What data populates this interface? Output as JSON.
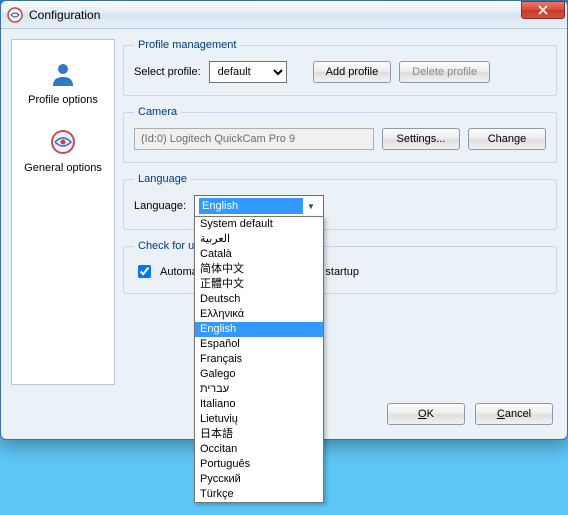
{
  "window": {
    "title": "Configuration"
  },
  "sidebar": {
    "items": [
      {
        "label": "Profile options",
        "icon": "user-icon"
      },
      {
        "label": "General options",
        "icon": "app-icon"
      }
    ]
  },
  "profile": {
    "legend": "Profile management",
    "select_label": "Select profile:",
    "selected": "default",
    "options": [
      "default"
    ],
    "add_btn": "Add profile",
    "delete_btn": "Delete profile"
  },
  "camera": {
    "legend": "Camera",
    "device": "(Id:0) Logitech QuickCam Pro 9",
    "settings_btn": "Settings...",
    "change_btn": "Change"
  },
  "language": {
    "legend": "Language",
    "label": "Language:",
    "selected": "English",
    "highlighted": "English",
    "options": [
      "System default",
      "العربية",
      "Català",
      "简体中文",
      "正體中文",
      "Deutsch",
      "Ελληνικά",
      "English",
      "Español",
      "Français",
      "Galego",
      "עברית",
      "Italiano",
      "Lietuvių",
      "日本語",
      "Occitan",
      "Português",
      "Русский",
      "Türkçe"
    ]
  },
  "updates": {
    "legend": "Check for updates",
    "checkbox_label_prefix": "Automati",
    "checkbox_label_suffix": "tes at startup",
    "checked": true
  },
  "footer": {
    "ok": "OK",
    "cancel": "Cancel"
  },
  "colors": {
    "highlight": "#3399ff",
    "legend_text": "#003a87"
  }
}
